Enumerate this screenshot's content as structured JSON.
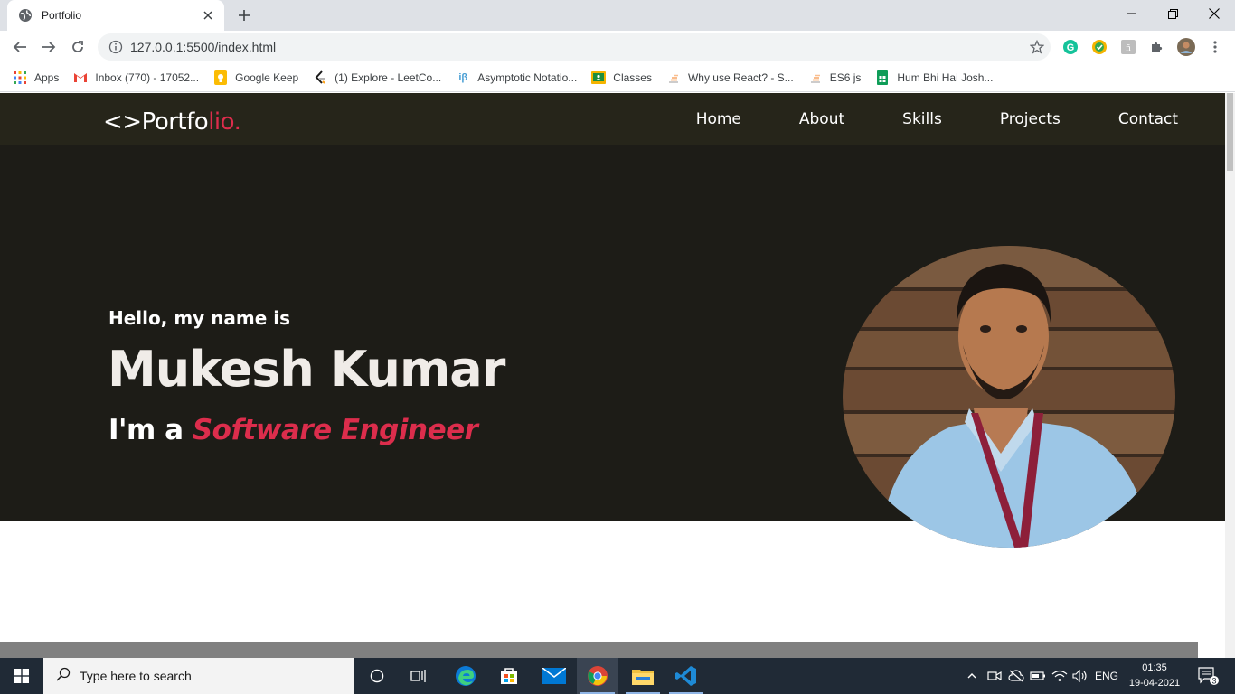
{
  "browser": {
    "tab_title": "Portfolio",
    "url": "127.0.0.1:5500/index.html",
    "bookmarks": [
      {
        "label": "Apps",
        "icon": "apps-grid-icon"
      },
      {
        "label": "Inbox (770) - 17052...",
        "icon": "gmail-icon"
      },
      {
        "label": "Google Keep",
        "icon": "google-keep-icon"
      },
      {
        "label": "(1) Explore - LeetCo...",
        "icon": "leetcode-icon"
      },
      {
        "label": "Asymptotic Notatio...",
        "icon": "ib-icon"
      },
      {
        "label": "Classes",
        "icon": "google-classroom-icon"
      },
      {
        "label": "Why use React? - S...",
        "icon": "stackoverflow-icon"
      },
      {
        "label": "ES6 js",
        "icon": "stackoverflow-icon"
      },
      {
        "label": "Hum Bhi Hai Josh...",
        "icon": "google-sheets-icon"
      }
    ]
  },
  "site": {
    "logo_main": "<>Portfo",
    "logo_accent": "lio.",
    "nav": [
      "Home",
      "About",
      "Skills",
      "Projects",
      "Contact"
    ],
    "hero": {
      "greeting": "Hello, my name is",
      "name": "Mukesh Kumar",
      "role_prefix": "I'm a ",
      "role": "Software Engineer"
    }
  },
  "taskbar": {
    "search_placeholder": "Type here to search",
    "language": "ENG",
    "time": "01:35",
    "date": "19-04-2021",
    "notification_count": "3"
  },
  "colors": {
    "nav_bg": "#26251a",
    "hero_bg": "#1d1c17",
    "accent": "#dc2d4c"
  }
}
